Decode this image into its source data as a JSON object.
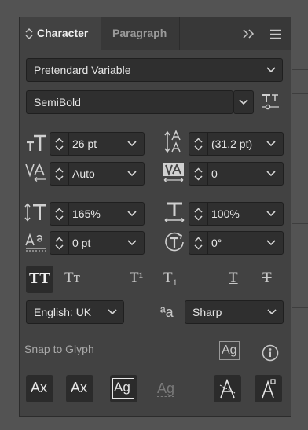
{
  "tabs": {
    "character": "Character",
    "paragraph": "Paragraph"
  },
  "font": {
    "family": "Pretendard Variable",
    "style": "SemiBold"
  },
  "metrics": {
    "font_size": "26 pt",
    "leading": "(31.2 pt)",
    "kerning": "Auto",
    "tracking": "0",
    "vertical_scale": "165%",
    "horizontal_scale": "100%",
    "baseline_shift": "0 pt",
    "rotation": "0°"
  },
  "language": "English: UK",
  "antialiasing": "Sharp",
  "snap": {
    "title": "Snap to Glyph"
  },
  "glyphs": {
    "tt": "TT",
    "tr": "Tт",
    "sup": "T¹",
    "sub": "T₁",
    "under": "T",
    "strike": "T",
    "aa": "ªa",
    "ag": "Ag",
    "ax": "Ax"
  }
}
